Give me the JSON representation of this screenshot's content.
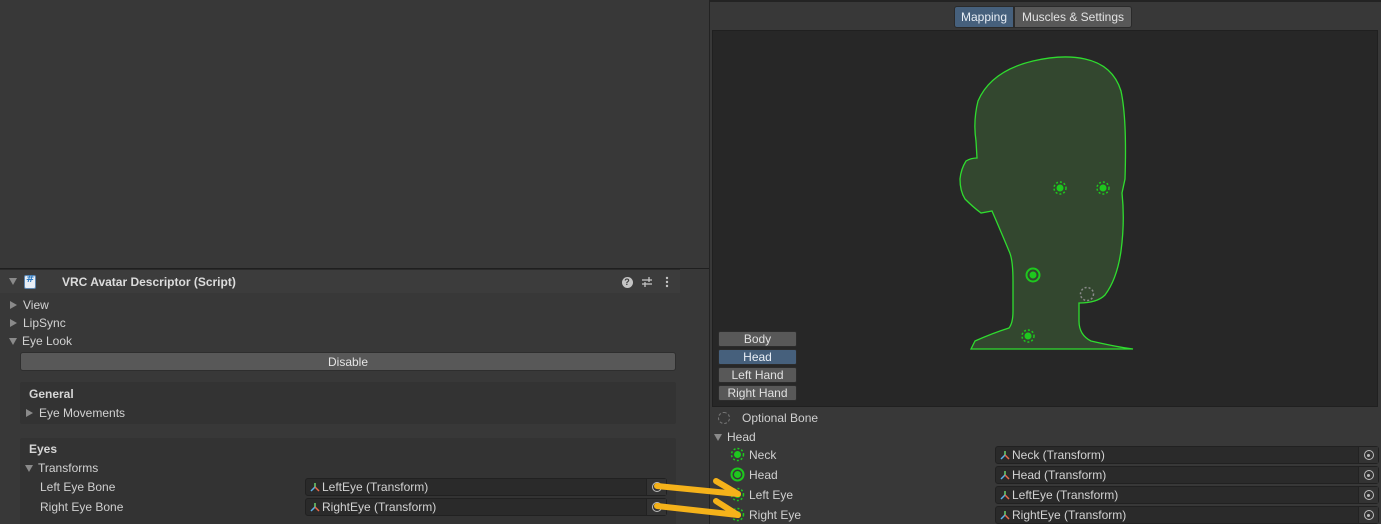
{
  "inspector": {
    "component_title": "VRC Avatar Descriptor (Script)",
    "header_icons": [
      "help-icon",
      "preset-icon",
      "kebab-menu-icon"
    ],
    "foldouts": [
      {
        "label": "View",
        "expanded": false
      },
      {
        "label": "LipSync",
        "expanded": false
      },
      {
        "label": "Eye Look",
        "expanded": true
      }
    ],
    "disable_button": "Disable",
    "general": {
      "title": "General",
      "eye_movements": "Eye Movements"
    },
    "eyes": {
      "title": "Eyes",
      "transforms": "Transforms",
      "fields": [
        {
          "label": "Left Eye Bone",
          "value": "LeftEye (Transform)"
        },
        {
          "label": "Right Eye Bone",
          "value": "RightEye (Transform)"
        }
      ]
    }
  },
  "avatar": {
    "tabs": [
      {
        "label": "Mapping",
        "active": true
      },
      {
        "label": "Muscles & Settings",
        "active": false
      }
    ],
    "body_parts": [
      {
        "label": "Body",
        "active": false
      },
      {
        "label": "Head",
        "active": true
      },
      {
        "label": "Left Hand",
        "active": false
      },
      {
        "label": "Right Hand",
        "active": false
      }
    ],
    "legend_optional": "Optional Bone",
    "group": "Head",
    "bones": [
      {
        "label": "Neck",
        "value": "Neck (Transform)",
        "kind": "optional-mapped"
      },
      {
        "label": "Head",
        "value": "Head (Transform)",
        "kind": "required-mapped"
      },
      {
        "label": "Left Eye",
        "value": "LeftEye (Transform)",
        "kind": "optional-mapped"
      },
      {
        "label": "Right Eye",
        "value": "RightEye (Transform)",
        "kind": "optional-mapped"
      }
    ]
  },
  "colors": {
    "accent_blue": "#46607c",
    "bone_green": "#1ec81e",
    "head_outline": "#2fdc2f",
    "head_fill": "#33472f",
    "annotation_arrow": "#f5b21a"
  }
}
